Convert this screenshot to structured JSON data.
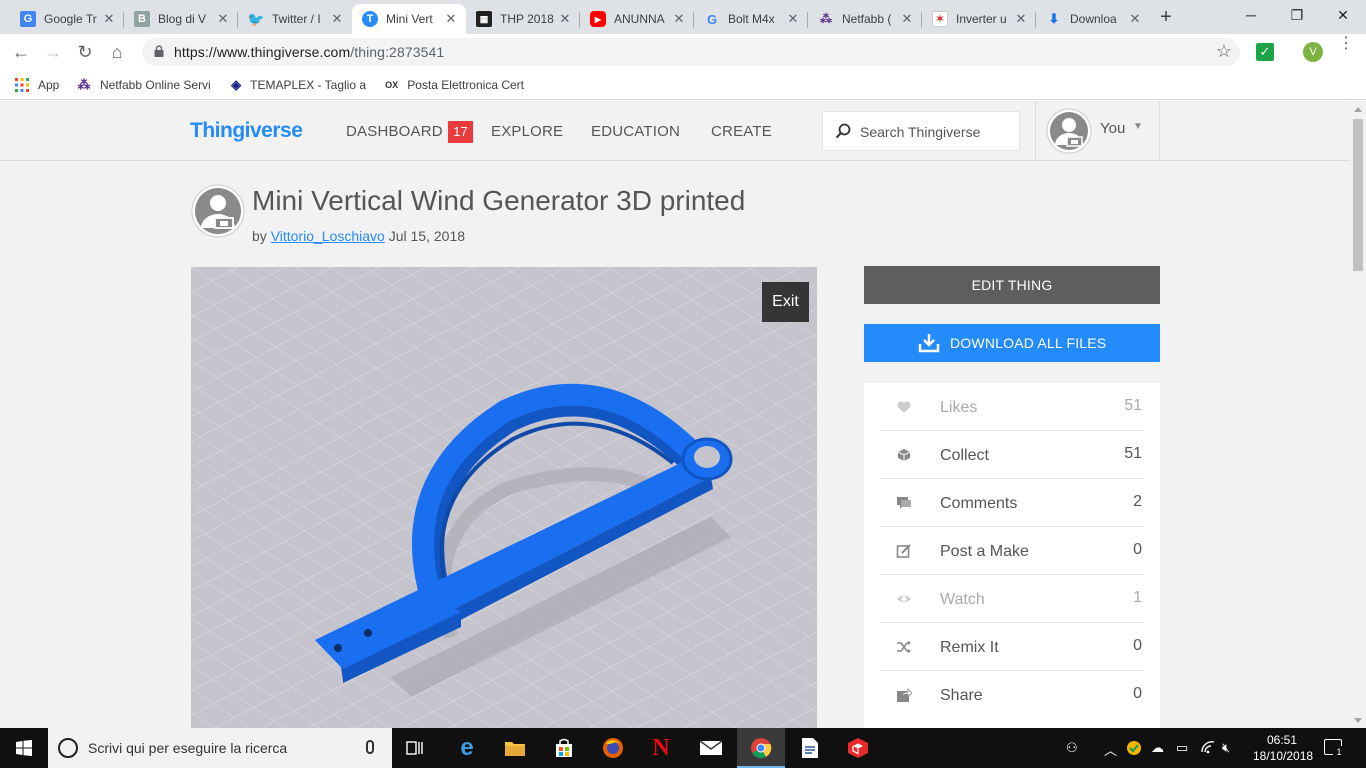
{
  "browser": {
    "tabs": [
      {
        "title": "Google Tr",
        "icon": "google-translate-icon"
      },
      {
        "title": "Blog di V",
        "icon": "blog-icon"
      },
      {
        "title": "Twitter / I",
        "icon": "twitter-icon"
      },
      {
        "title": "Mini Vert",
        "icon": "thingiverse-icon",
        "active": true
      },
      {
        "title": "THP 2018",
        "icon": "qr-icon"
      },
      {
        "title": "ANUNNA",
        "icon": "youtube-icon"
      },
      {
        "title": "Bolt M4x",
        "icon": "google-icon"
      },
      {
        "title": "Netfabb (",
        "icon": "netfabb-icon"
      },
      {
        "title": "Inverter u",
        "icon": "inverter-icon"
      },
      {
        "title": "Downloa",
        "icon": "download-icon"
      }
    ],
    "url_host": "https://www.thingiverse.com",
    "url_path": "/thing:2873541",
    "profile_initial": "V",
    "bookmarks": [
      {
        "label": "App",
        "icon": "apps-grid-icon"
      },
      {
        "label": "Netfabb Online Servi",
        "icon": "netfabb-icon"
      },
      {
        "label": "TEMAPLEX - Taglio a",
        "icon": "temaplex-icon"
      },
      {
        "label": "Posta Elettronica Cert",
        "icon": "pec-icon"
      }
    ]
  },
  "site": {
    "logo": "Thingiverse",
    "nav": {
      "dashboard": "DASHBOARD",
      "dashboard_badge": "17",
      "explore": "EXPLORE",
      "education": "EDUCATION",
      "create": "CREATE"
    },
    "search_placeholder": "Search Thingiverse",
    "user_label": "You"
  },
  "thing": {
    "title": "Mini Vertical Wind Generator 3D printed",
    "by": "by",
    "author": "Vittorio_Loschiavo",
    "date": "Jul 15, 2018",
    "viewer_exit": "Exit",
    "model_color": "#1a6ef0"
  },
  "actions": {
    "edit": "EDIT THING",
    "download": "DOWNLOAD ALL FILES"
  },
  "stats": [
    {
      "label": "Likes",
      "count": "51",
      "icon": "heart-icon",
      "dim": true
    },
    {
      "label": "Collect",
      "count": "51",
      "icon": "collect-icon",
      "dim": false
    },
    {
      "label": "Comments",
      "count": "2",
      "icon": "comments-icon",
      "dim": false
    },
    {
      "label": "Post a Make",
      "count": "0",
      "icon": "post-make-icon",
      "dim": false
    },
    {
      "label": "Watch",
      "count": "1",
      "icon": "eye-icon",
      "dim": true
    },
    {
      "label": "Remix It",
      "count": "0",
      "icon": "remix-icon",
      "dim": false
    },
    {
      "label": "Share",
      "count": "0",
      "icon": "share-icon",
      "dim": false
    }
  ],
  "taskbar": {
    "search_text": "Scrivi qui per eseguire la ricerca",
    "time": "06:51",
    "date": "18/10/2018",
    "notification_count": "1"
  },
  "colors": {
    "brand_blue": "#248bfb",
    "badge_red": "#e93b3b",
    "edit_gray": "#5e5e5e"
  }
}
